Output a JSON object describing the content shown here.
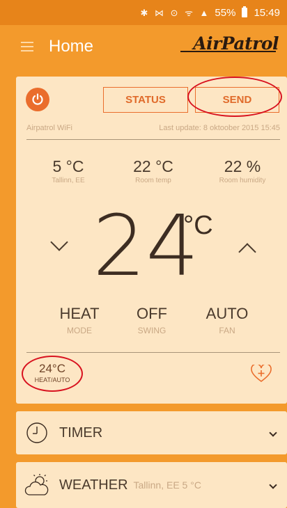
{
  "status_bar": {
    "battery": "55%",
    "time": "15:49"
  },
  "app_bar": {
    "title": "Home",
    "logo": "AirPatrol"
  },
  "main": {
    "status_label": "STATUS",
    "send_label": "SEND",
    "device_name": "Airpatrol WiFi",
    "last_update": "Last update: 8 oktoober 2015 15:45",
    "readings": [
      {
        "value": "5 °C",
        "label": "Tallinn, EE"
      },
      {
        "value": "22 °C",
        "label": "Room temp"
      },
      {
        "value": "22 %",
        "label": "Room humidity"
      }
    ],
    "setpoint": "24",
    "setpoint_unit": "°C",
    "modes": [
      {
        "value": "HEAT",
        "label": "MODE"
      },
      {
        "value": "OFF",
        "label": "SWING"
      },
      {
        "value": "AUTO",
        "label": "FAN"
      }
    ],
    "preset": {
      "value": "24°C",
      "label": "HEAT/AUTO"
    }
  },
  "timer": {
    "label": "TIMER"
  },
  "weather": {
    "label": "WEATHER",
    "sub": "Tallinn, EE 5 °C"
  },
  "colors": {
    "accent": "#f39a2c",
    "card": "#fde6c4",
    "orange": "#ea6d2c",
    "highlight": "#d8121f"
  }
}
